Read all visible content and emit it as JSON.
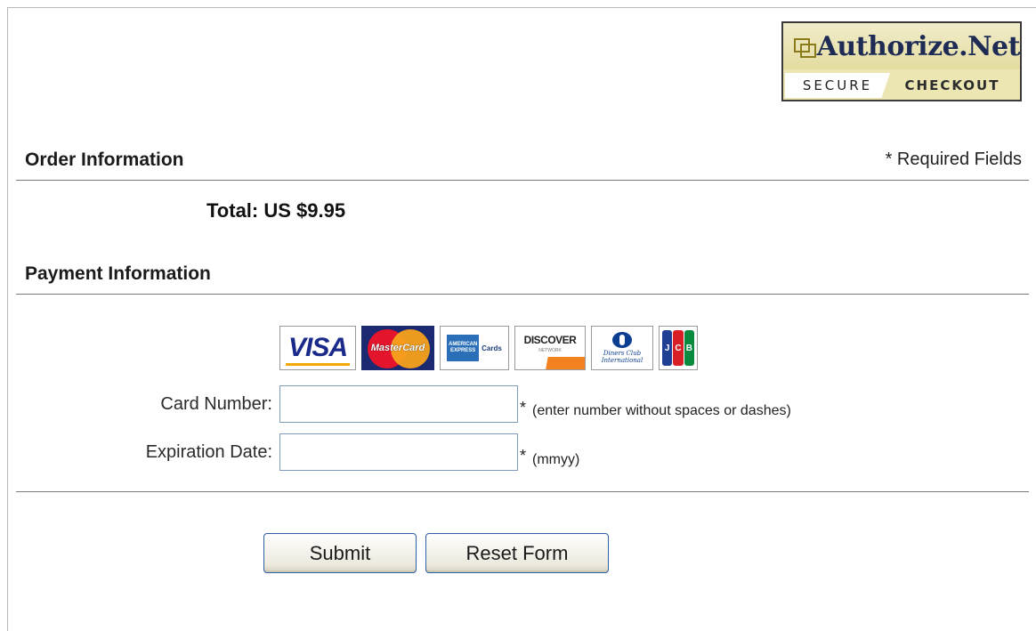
{
  "seal": {
    "brand": "Authorize.Net",
    "secure": "SECURE",
    "checkout": "CHECKOUT"
  },
  "order": {
    "title": "Order Information",
    "required_note": "* Required Fields",
    "total": "Total: US $9.95"
  },
  "payment": {
    "title": "Payment Information",
    "card_logos": {
      "visa": "VISA",
      "mastercard": "MasterCard",
      "amex": "AMERICAN EXPRESS",
      "amex_suffix": "Cards",
      "discover": "DISCOVER",
      "discover_sub": "NETWORK",
      "diners": "Diners Club International",
      "jcb": [
        "J",
        "C",
        "B"
      ]
    },
    "card_number": {
      "label": "Card Number:",
      "value": "",
      "placeholder": "",
      "asterisk": "*",
      "hint": "(enter number without spaces or dashes)"
    },
    "expiration": {
      "label": "Expiration Date:",
      "value": "",
      "placeholder": "",
      "asterisk": "*",
      "hint": "(mmyy)"
    }
  },
  "buttons": {
    "submit": "Submit",
    "reset": "Reset Form"
  }
}
